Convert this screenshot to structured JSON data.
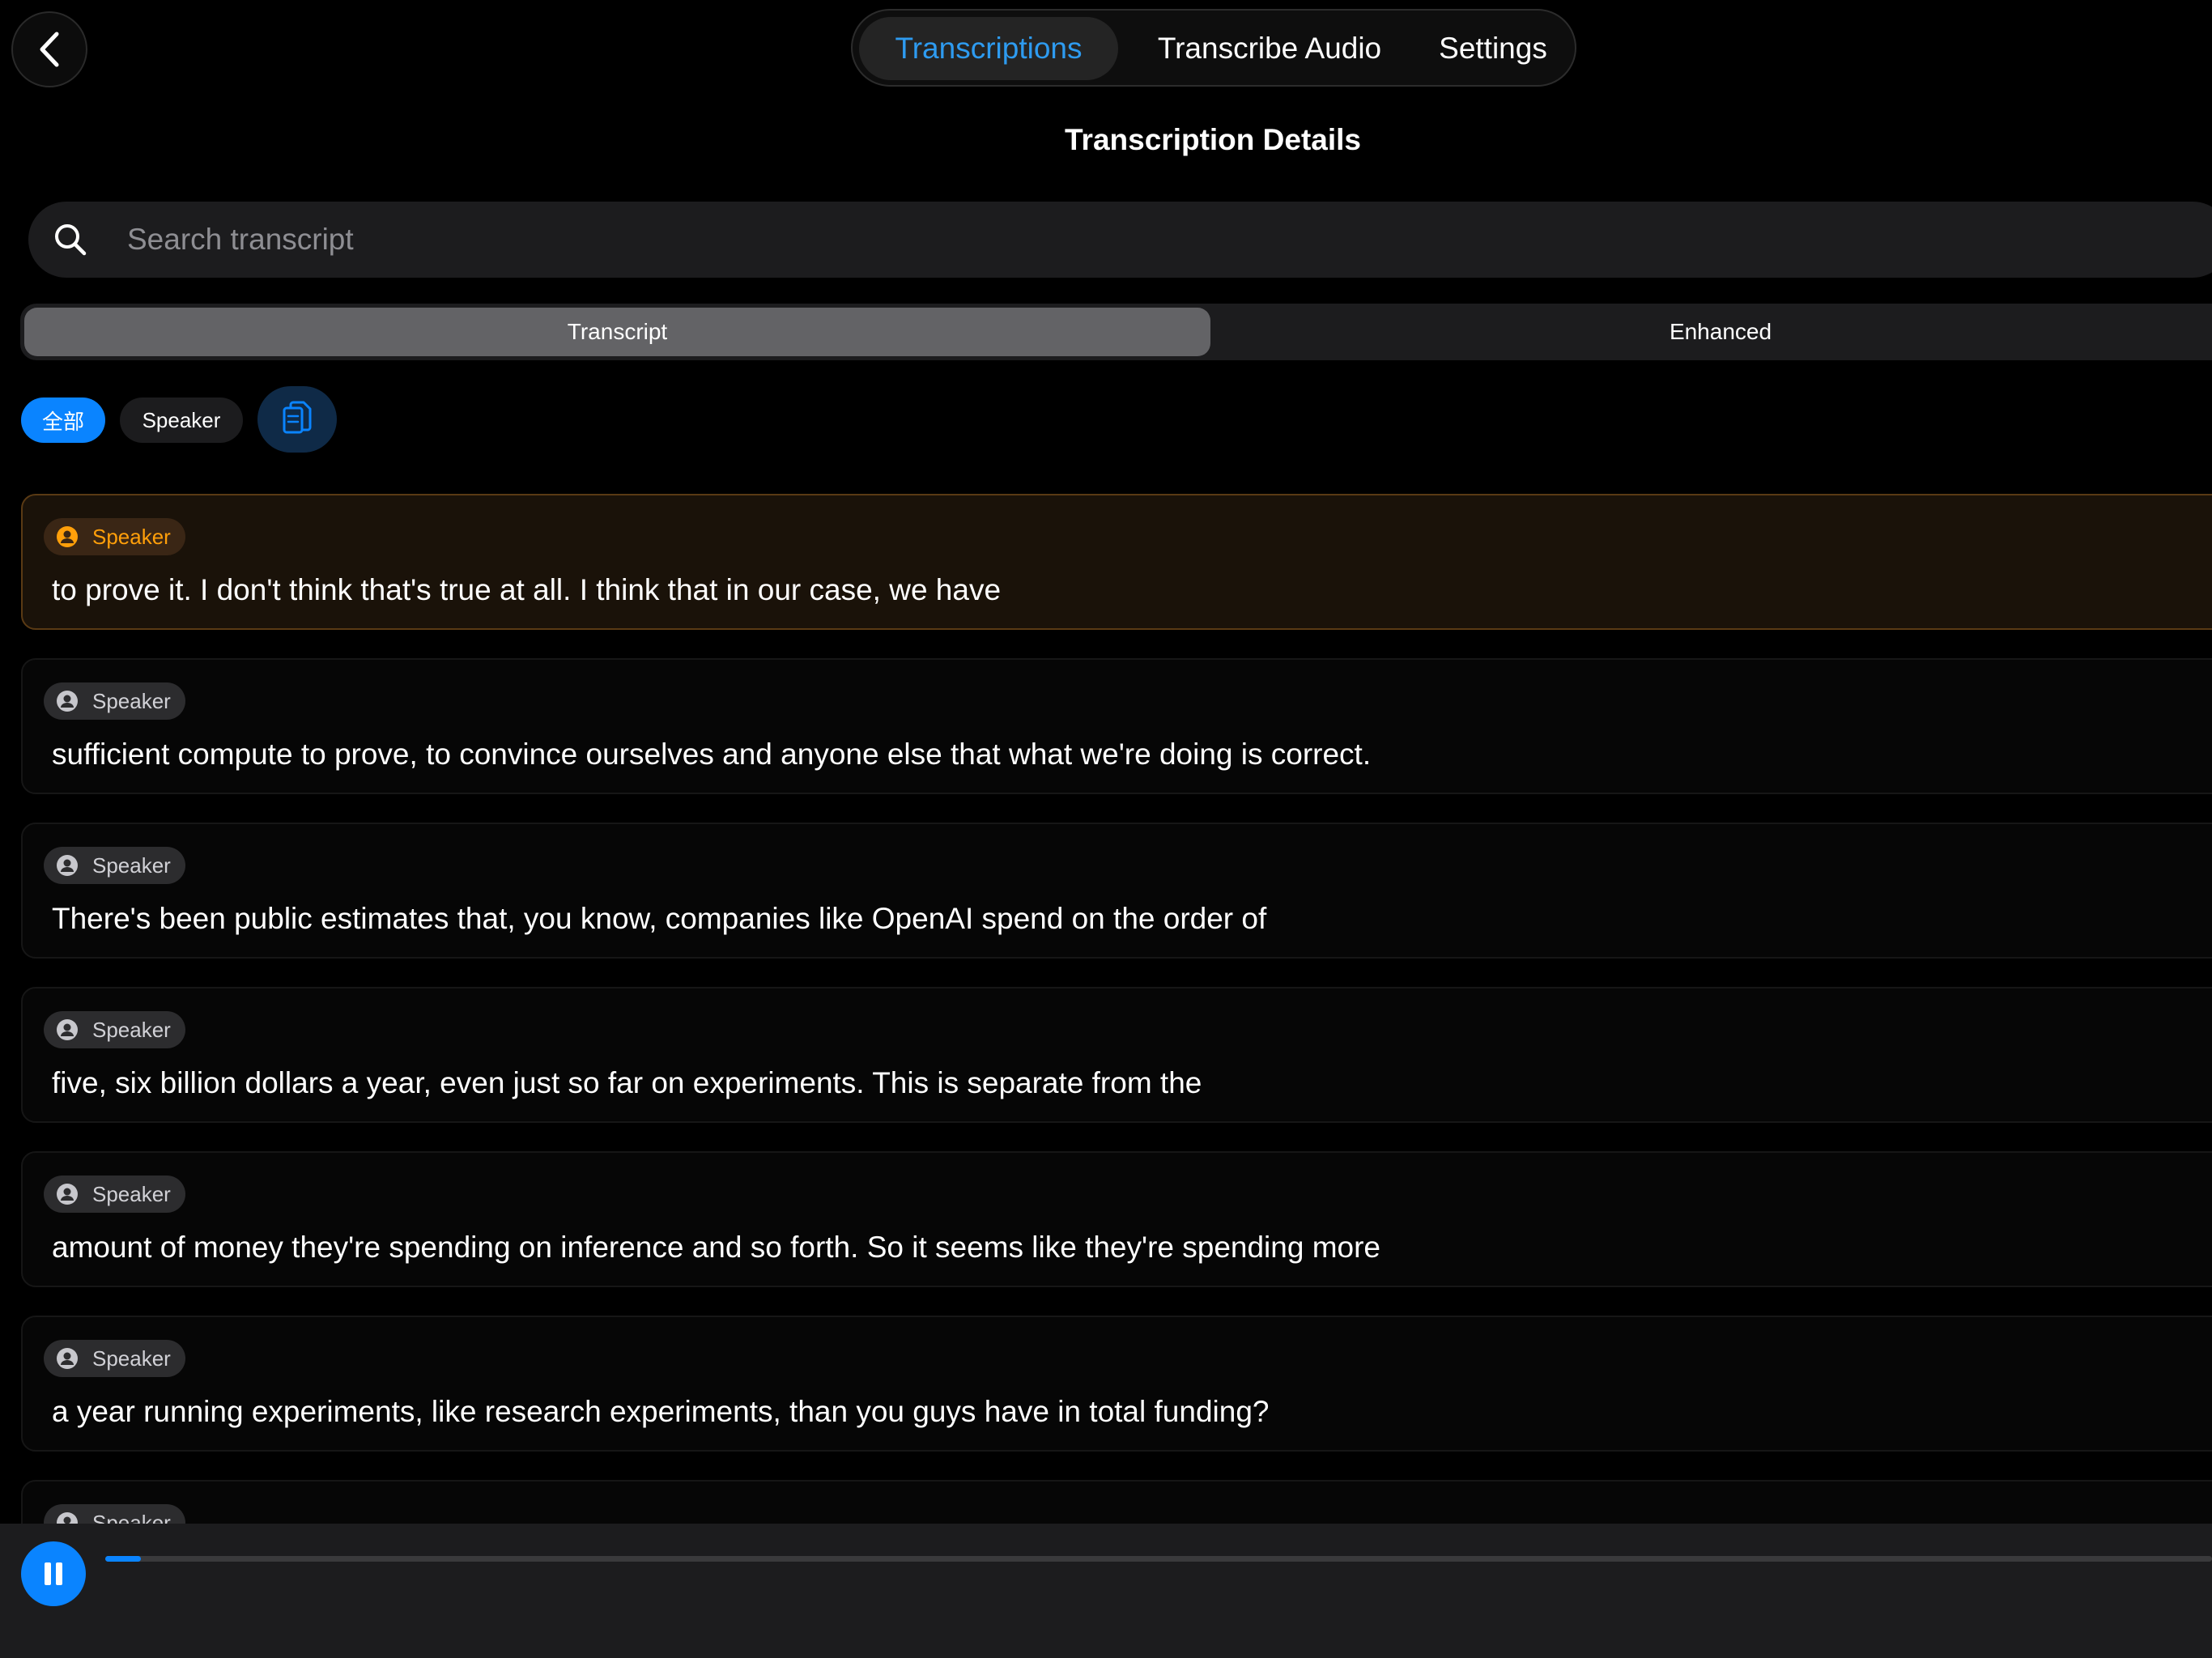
{
  "nav": {
    "back_icon": "chevron-left-icon",
    "tabs": [
      {
        "label": "Transcriptions",
        "active": true
      },
      {
        "label": "Transcribe Audio",
        "active": false
      },
      {
        "label": "Settings",
        "active": false
      }
    ]
  },
  "page_title": "Transcription Details",
  "search": {
    "placeholder": "Search transcript",
    "value": "",
    "icon": "search-icon"
  },
  "view_toggle": [
    {
      "label": "Transcript",
      "active": true
    },
    {
      "label": "Enhanced",
      "active": false
    }
  ],
  "filters": {
    "all_label": "全部",
    "speaker_label": "Speaker",
    "copy_icon": "copy-icon"
  },
  "segments": [
    {
      "speaker": "Speaker",
      "text": "to prove it. I don't think that's true at all. I think that in our case, we have",
      "active": true
    },
    {
      "speaker": "Speaker",
      "text": "sufficient compute to prove, to convince ourselves and anyone else that what we're doing is correct.",
      "active": false
    },
    {
      "speaker": "Speaker",
      "text": "There's been public estimates that, you know, companies like OpenAI spend on the order of",
      "active": false
    },
    {
      "speaker": "Speaker",
      "text": "five, six billion dollars a year, even just so far on experiments. This is separate from the",
      "active": false
    },
    {
      "speaker": "Speaker",
      "text": "amount of money they're spending on inference and so forth. So it seems like they're spending more",
      "active": false
    },
    {
      "speaker": "Speaker",
      "text": "a year running experiments, like research experiments, than you guys have in total funding?",
      "active": false
    },
    {
      "speaker": "Speaker",
      "text": "",
      "active": false
    }
  ],
  "player": {
    "state": "playing",
    "icon": "pause-icon",
    "progress": 0.017
  },
  "colors": {
    "accent": "#0a84ff",
    "active_tab": "#2e9bf0",
    "highlight": "#ff9f0a"
  }
}
